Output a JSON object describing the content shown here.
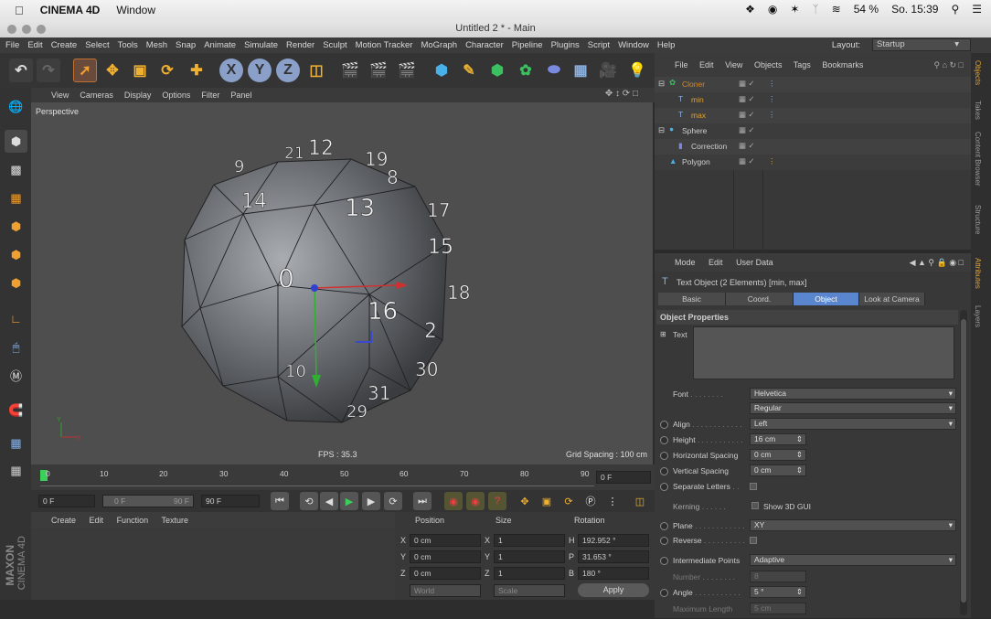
{
  "mac_menu": {
    "app": "CINEMA 4D",
    "window": "Window",
    "battery": "54 %",
    "clock": "So. 15:39"
  },
  "window_title": "Untitled 2 * - Main",
  "menus": [
    "File",
    "Edit",
    "Create",
    "Select",
    "Tools",
    "Mesh",
    "Snap",
    "Animate",
    "Simulate",
    "Render",
    "Sculpt",
    "Motion Tracker",
    "MoGraph",
    "Character",
    "Pipeline",
    "Plugins",
    "Script",
    "Window",
    "Help"
  ],
  "layout": {
    "label": "Layout:",
    "value": "Startup"
  },
  "viewport": {
    "menus": [
      "View",
      "Cameras",
      "Display",
      "Options",
      "Filter",
      "Panel"
    ],
    "name": "Perspective",
    "fps": "FPS : 35.3",
    "grid_spacing": "Grid Spacing : 100 cm",
    "numbers": [
      "21",
      "12",
      "9",
      "19",
      "8",
      "14",
      "13",
      "17",
      "15",
      "0",
      "18",
      "16",
      "2",
      "30",
      "31",
      "29",
      "10"
    ]
  },
  "timeline": {
    "ticks": [
      "0",
      "10",
      "20",
      "30",
      "40",
      "50",
      "60",
      "70",
      "80",
      "90"
    ],
    "current_frame": "0 F",
    "start": "0 F",
    "min": "0 F",
    "max": "90 F",
    "end": "90 F"
  },
  "material_manager": {
    "menus": [
      "Create",
      "Edit",
      "Function",
      "Texture"
    ]
  },
  "coordinates": {
    "headers": [
      "Position",
      "Size",
      "Rotation"
    ],
    "rows": [
      {
        "axis": "X",
        "pos": "0 cm",
        "size_axis": "X",
        "size": "1",
        "rot_axis": "H",
        "rot": "192.952 °"
      },
      {
        "axis": "Y",
        "pos": "0 cm",
        "size_axis": "Y",
        "size": "1",
        "rot_axis": "P",
        "rot": "31.653 °"
      },
      {
        "axis": "Z",
        "pos": "0 cm",
        "size_axis": "Z",
        "size": "1",
        "rot_axis": "B",
        "rot": "180 °"
      }
    ],
    "mode": "World",
    "scale": "Scale",
    "apply": "Apply"
  },
  "object_manager": {
    "menus": [
      "File",
      "Edit",
      "View",
      "Objects",
      "Tags",
      "Bookmarks"
    ],
    "objects": [
      {
        "name": "Cloner",
        "indent": 0,
        "color": "#d28a2a"
      },
      {
        "name": "min",
        "indent": 1,
        "color": "#e0a030"
      },
      {
        "name": "max",
        "indent": 1,
        "color": "#e0a030"
      },
      {
        "name": "Sphere",
        "indent": 0,
        "color": "#cfcfcf"
      },
      {
        "name": "Correction",
        "indent": 1,
        "color": "#cfcfcf"
      },
      {
        "name": "Polygon",
        "indent": 0,
        "color": "#cfcfcf"
      }
    ]
  },
  "attributes": {
    "menus": [
      "Mode",
      "Edit",
      "User Data"
    ],
    "object_title": "Text Object (2 Elements) [min, max]",
    "tabs": [
      "Basic",
      "Coord.",
      "Object",
      "Look at Camera"
    ],
    "active_tab": "Object",
    "section": "Object Properties",
    "text_label": "Text",
    "font_label": "Font",
    "font_value": "Helvetica",
    "font_style": "Regular",
    "align_label": "Align",
    "align_value": "Left",
    "height_label": "Height",
    "height_value": "16 cm",
    "hspacing_label": "Horizontal Spacing",
    "hspacing_value": "0 cm",
    "vspacing_label": "Vertical Spacing",
    "vspacing_value": "0 cm",
    "separate_label": "Separate Letters",
    "kerning_label": "Kerning",
    "show3d_label": "Show 3D GUI",
    "plane_label": "Plane",
    "plane_value": "XY",
    "reverse_label": "Reverse",
    "intermediate_label": "Intermediate Points",
    "intermediate_value": "Adaptive",
    "number_label": "Number",
    "number_value": "8",
    "angle_label": "Angle",
    "angle_value": "5 °",
    "maxlen_label": "Maximum Length",
    "maxlen_value": "5 cm"
  },
  "side_tabs": [
    "Objects",
    "Takes",
    "Content Browser",
    "Structure",
    "Attributes",
    "Layers"
  ],
  "branding": {
    "maxon": "MAXON",
    "c4d": "CINEMA 4D"
  }
}
